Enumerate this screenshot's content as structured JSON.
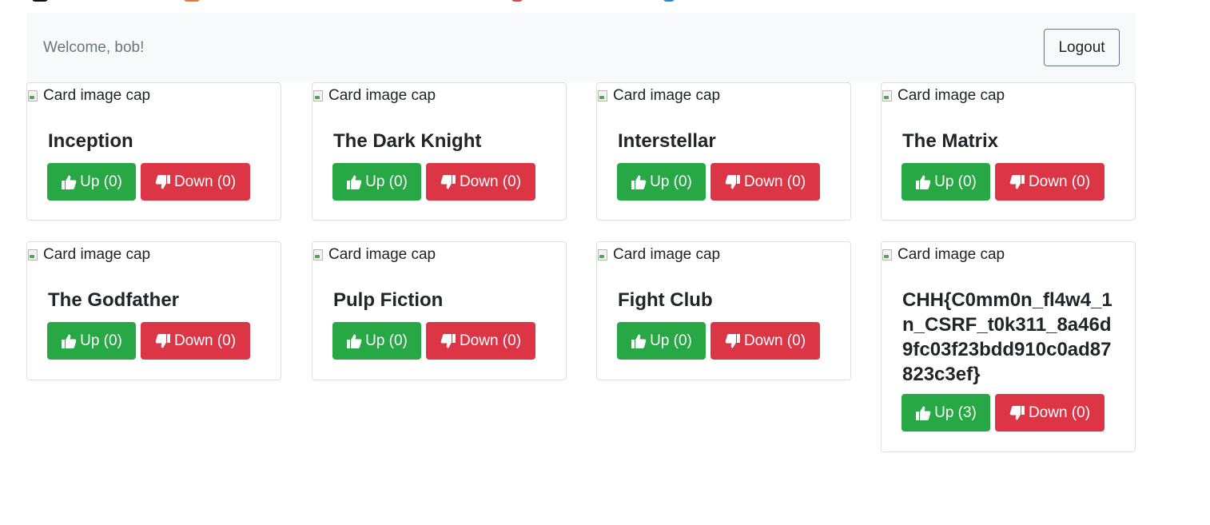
{
  "colors": {
    "navbar_bg": "#f8f9fa",
    "up_button": "#28a745",
    "down_button": "#dc3545",
    "welcome_text": "#6c757d"
  },
  "header": {
    "welcome": "Welcome, bob!",
    "logout_label": "Logout"
  },
  "image_alt": "Card image cap",
  "movies": [
    {
      "title": "Inception",
      "up": "Up (0)",
      "down": "Down (0)"
    },
    {
      "title": "The Dark Knight",
      "up": "Up (0)",
      "down": "Down (0)"
    },
    {
      "title": "Interstellar",
      "up": "Up (0)",
      "down": "Down (0)"
    },
    {
      "title": "The Matrix",
      "up": "Up (0)",
      "down": "Down (0)"
    },
    {
      "title": "The Godfather",
      "up": "Up (0)",
      "down": "Down (0)"
    },
    {
      "title": "Pulp Fiction",
      "up": "Up (0)",
      "down": "Down (0)"
    },
    {
      "title": "Fight Club",
      "up": "Up (0)",
      "down": "Down (0)"
    },
    {
      "title": "CHH{C0mm0n_fl4w4_1n_CSRF_t0k311_8a46d9fc03f23bdd910c0ad87823c3ef}",
      "up": "Up (3)",
      "down": "Down (0)"
    }
  ]
}
